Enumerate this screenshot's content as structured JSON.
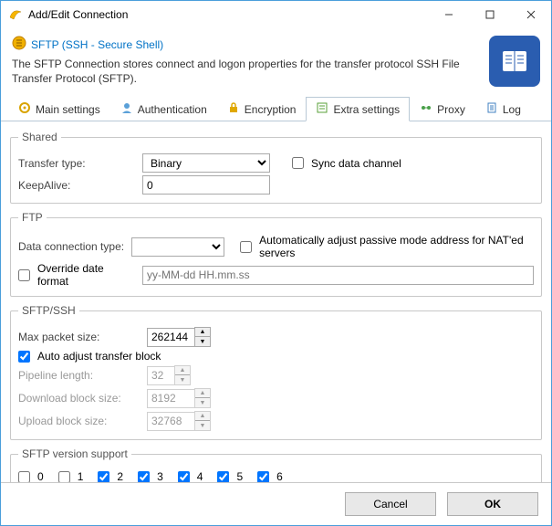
{
  "window": {
    "title": "Add/Edit Connection"
  },
  "header": {
    "title": "SFTP (SSH - Secure Shell)",
    "description": "The SFTP Connection stores connect and logon properties for the transfer protocol SSH File Transfer Protocol (SFTP)."
  },
  "tabs": {
    "main": "Main settings",
    "auth": "Authentication",
    "encryption": "Encryption",
    "extra": "Extra settings",
    "proxy": "Proxy",
    "log": "Log"
  },
  "shared": {
    "legend": "Shared",
    "transfer_type_label": "Transfer type:",
    "transfer_type_value": "Binary",
    "sync_label": "Sync data channel",
    "keepalive_label": "KeepAlive:",
    "keepalive_value": "0"
  },
  "ftp": {
    "legend": "FTP",
    "conn_type_label": "Data connection type:",
    "conn_type_value": "",
    "auto_nat_label": "Automatically adjust passive mode address for NAT'ed servers",
    "override_date_label": "Override date format",
    "date_placeholder": "yy-MM-dd HH.mm.ss"
  },
  "sftp": {
    "legend": "SFTP/SSH",
    "max_packet_label": "Max packet size:",
    "max_packet_value": "262144",
    "auto_adjust_label": "Auto adjust transfer block",
    "pipeline_label": "Pipeline length:",
    "pipeline_value": "32",
    "download_label": "Download block size:",
    "download_value": "8192",
    "upload_label": "Upload block size:",
    "upload_value": "32768"
  },
  "version": {
    "legend": "SFTP version support",
    "v0": "0",
    "v1": "1",
    "v2": "2",
    "v3": "3",
    "v4": "4",
    "v5": "5",
    "v6": "6"
  },
  "footer": {
    "cancel": "Cancel",
    "ok": "OK"
  }
}
